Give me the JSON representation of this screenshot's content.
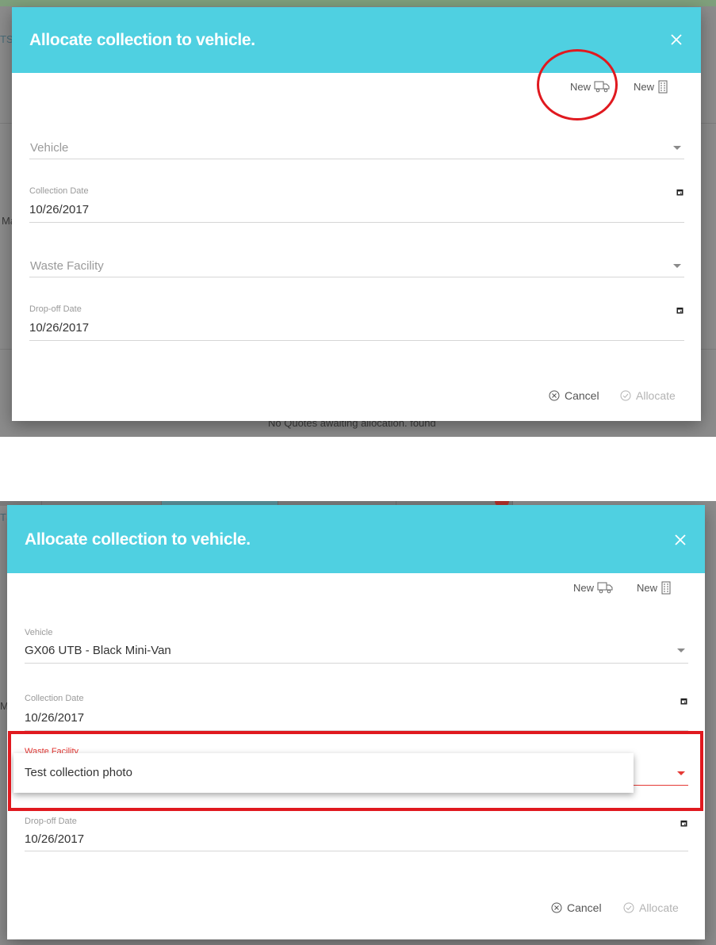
{
  "colors": {
    "header": "#4fd0e1",
    "annotation": "#e0191f",
    "focus": "#e53935"
  },
  "icons": {
    "close": "close-icon",
    "truck": "truck-icon",
    "building": "building-icon",
    "calendar": "calendar-icon",
    "dropdown": "chevron-down-icon",
    "cancel": "cancel-circle-icon",
    "allocate": "check-circle-icon"
  },
  "background": {
    "tab_fragment": "TS",
    "row_fragment": "Ma",
    "empty_message": "No Quotes awaiting allocation. found"
  },
  "dialog_top": {
    "title": "Allocate collection to vehicle.",
    "new_vehicle_label": "New",
    "new_facility_label": "New",
    "vehicle": {
      "placeholder": "Vehicle",
      "value": ""
    },
    "collection_date": {
      "label": "Collection Date",
      "value": "10/26/2017"
    },
    "waste_facility": {
      "placeholder": "Waste Facility",
      "value": ""
    },
    "dropoff_date": {
      "label": "Drop-off Date",
      "value": "10/26/2017"
    },
    "cancel_label": "Cancel",
    "allocate_label": "Allocate"
  },
  "dialog_bottom": {
    "title": "Allocate collection to vehicle.",
    "new_vehicle_label": "New",
    "new_facility_label": "New",
    "vehicle": {
      "label": "Vehicle",
      "value": "GX06 UTB - Black Mini-Van"
    },
    "collection_date": {
      "label": "Collection Date",
      "value": "10/26/2017"
    },
    "waste_facility": {
      "label": "Waste Facility",
      "options": [
        "Test collection photo"
      ]
    },
    "dropoff_date": {
      "label": "Drop-off Date",
      "value": "10/26/2017"
    },
    "cancel_label": "Cancel",
    "allocate_label": "Allocate"
  }
}
